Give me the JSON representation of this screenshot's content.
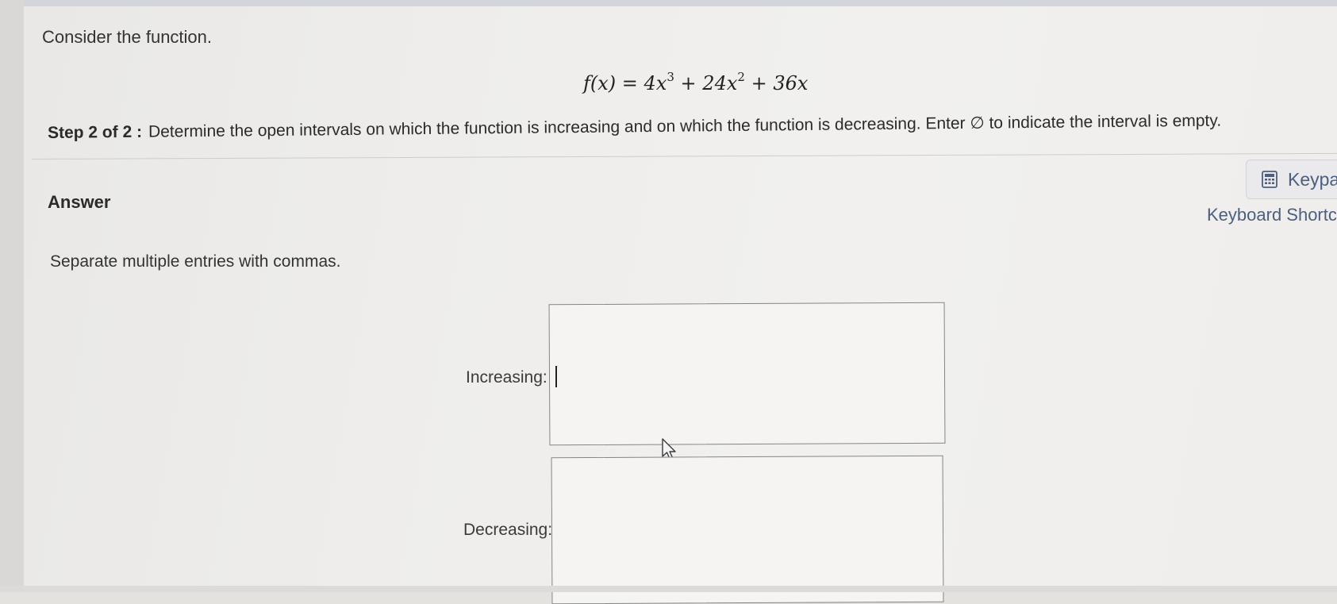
{
  "question": {
    "intro": "Consider the function.",
    "function": {
      "lhs": "f(x)",
      "equals": "=",
      "term1_coef": "4x",
      "term1_exp": "3",
      "plus1": "+",
      "term2_coef": "24x",
      "term2_exp": "2",
      "plus2": "+",
      "term3": "36x"
    },
    "step_label": "Step 2 of 2 :",
    "step_text": "Determine the open intervals on which the function is increasing and on which the function is decreasing. Enter ∅ to indicate the interval is empty."
  },
  "answer": {
    "heading": "Answer",
    "instruction": "Separate multiple entries with commas.",
    "fields": {
      "increasing_label": "Increasing:",
      "increasing_value": "",
      "decreasing_label": "Decreasing:",
      "decreasing_value": ""
    }
  },
  "tools": {
    "keypad_label": "Keypad",
    "keypad_icon": "calculator-icon",
    "shortcuts_label": "Keyboard Shortcuts"
  },
  "colors": {
    "link_blue": "#4c5f80",
    "box_border": "#858585",
    "background": "#eeedeb"
  }
}
